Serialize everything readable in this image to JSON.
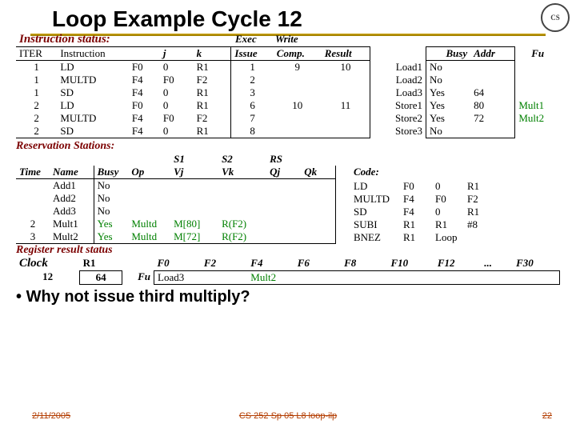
{
  "title": "Loop Example Cycle 12",
  "logo_text": "CS",
  "labels": {
    "instr_status": "Instruction status:",
    "exec": "Exec",
    "write": "Write",
    "reserv": "Reservation Stations:",
    "reg_result": "Register result status",
    "clock": "Clock"
  },
  "headers": {
    "iter": "ITER",
    "instr": "Instruction",
    "j": "j",
    "k": "k",
    "issue": "Issue",
    "comp": "Comp.",
    "result": "Result",
    "busy": "Busy",
    "addr": "Addr",
    "fu": "Fu",
    "time": "Time",
    "name": "Name",
    "op": "Op",
    "vj": "Vj",
    "vk": "Vk",
    "qj": "Qj",
    "qk": "Qk",
    "s1": "S1",
    "s2": "S2",
    "rs": "RS",
    "code": "Code:"
  },
  "instructions": [
    {
      "iter": "1",
      "op": "LD",
      "d": "F0",
      "j": "0",
      "k": "R1",
      "issue": "1",
      "comp": "9",
      "wr": "10",
      "unit": "Load1",
      "busy": "No",
      "addr": "",
      "fu": ""
    },
    {
      "iter": "1",
      "op": "MULTD",
      "d": "F4",
      "j": "F0",
      "k": "F2",
      "issue": "2",
      "comp": "",
      "wr": "",
      "unit": "Load2",
      "busy": "No",
      "addr": "",
      "fu": ""
    },
    {
      "iter": "1",
      "op": "SD",
      "d": "F4",
      "j": "0",
      "k": "R1",
      "issue": "3",
      "comp": "",
      "wr": "",
      "unit": "Load3",
      "busy": "Yes",
      "addr": "64",
      "fu": ""
    },
    {
      "iter": "2",
      "op": "LD",
      "d": "F0",
      "j": "0",
      "k": "R1",
      "issue": "6",
      "comp": "10",
      "wr": "11",
      "unit": "Store1",
      "busy": "Yes",
      "addr": "80",
      "fu": "Mult1"
    },
    {
      "iter": "2",
      "op": "MULTD",
      "d": "F4",
      "j": "F0",
      "k": "F2",
      "issue": "7",
      "comp": "",
      "wr": "",
      "unit": "Store2",
      "busy": "Yes",
      "addr": "72",
      "fu": "Mult2"
    },
    {
      "iter": "2",
      "op": "SD",
      "d": "F4",
      "j": "0",
      "k": "R1",
      "issue": "8",
      "comp": "",
      "wr": "",
      "unit": "Store3",
      "busy": "No",
      "addr": "",
      "fu": ""
    }
  ],
  "reservation": [
    {
      "time": "",
      "name": "Add1",
      "busy": "No",
      "op": "",
      "vj": "",
      "vk": "",
      "qj": "",
      "qk": ""
    },
    {
      "time": "",
      "name": "Add2",
      "busy": "No",
      "op": "",
      "vj": "",
      "vk": "",
      "qj": "",
      "qk": ""
    },
    {
      "time": "",
      "name": "Add3",
      "busy": "No",
      "op": "",
      "vj": "",
      "vk": "",
      "qj": "",
      "qk": ""
    },
    {
      "time": "2",
      "name": "Mult1",
      "busy": "Yes",
      "op": "Multd",
      "vj": "M[80]",
      "vk": "R(F2)",
      "qj": "",
      "qk": ""
    },
    {
      "time": "3",
      "name": "Mult2",
      "busy": "Yes",
      "op": "Multd",
      "vj": "M[72]",
      "vk": "R(F2)",
      "qj": "",
      "qk": ""
    }
  ],
  "code_listing": [
    {
      "op": "LD",
      "a": "F0",
      "b": "0",
      "c": "R1"
    },
    {
      "op": "MULTD",
      "a": "F4",
      "b": "F0",
      "c": "F2"
    },
    {
      "op": "SD",
      "a": "F4",
      "b": "0",
      "c": "R1"
    },
    {
      "op": "SUBI",
      "a": "R1",
      "b": "R1",
      "c": "#8"
    },
    {
      "op": "BNEZ",
      "a": "R1",
      "b": "Loop",
      "c": ""
    }
  ],
  "reg_headers": [
    "R1",
    "F0",
    "F2",
    "F4",
    "F6",
    "F8",
    "F10",
    "F12",
    "...",
    "F30"
  ],
  "clock_val": "12",
  "r1_val": "64",
  "fu_label": "Fu",
  "reg_vals": {
    "f0": "Load3",
    "f4": "Mult2"
  },
  "bullet": "Why not issue third multiply?",
  "footer": {
    "date": "2/11/2005",
    "mid": "CS 252 Sp 05 L8 loop-ilp",
    "page": "22"
  }
}
